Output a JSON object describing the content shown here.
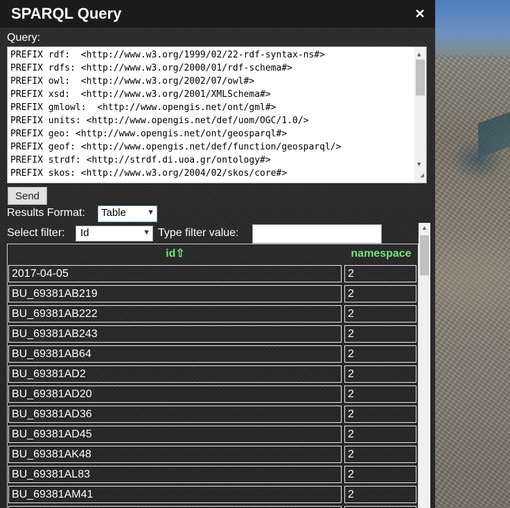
{
  "window": {
    "title": "SPARQL Query",
    "close_symbol": "✕"
  },
  "query": {
    "label": "Query:",
    "lines": [
      "PREFIX rdf:  <http://www.w3.org/1999/02/22-rdf-syntax-ns#>",
      "PREFIX rdfs: <http://www.w3.org/2000/01/rdf-schema#>",
      "PREFIX owl:  <http://www.w3.org/2002/07/owl#>",
      "PREFIX xsd:  <http://www.w3.org/2001/XMLSchema#>",
      "PREFIX gmlowl:  <http://www.opengis.net/ont/gml#>",
      "PREFIX units: <http://www.opengis.net/def/uom/OGC/1.0/>",
      "PREFIX geo: <http://www.opengis.net/ont/geosparql#>",
      "PREFIX geof: <http://www.opengis.net/def/function/geosparql/>",
      "PREFIX strdf: <http://strdf.di.uoa.gr/ontology#>",
      "PREFIX skos: <http://www.w3.org/2004/02/skos/core#>"
    ]
  },
  "send_label": "Send",
  "results_format": {
    "label": "Results Format:",
    "selected": "Table"
  },
  "filter": {
    "label": "Select filter:",
    "selected": "Id",
    "value_label": "Type filter value:",
    "value": ""
  },
  "table": {
    "headers": [
      "id⇧",
      "namespace"
    ],
    "rows": [
      [
        "2017-04-05",
        "2"
      ],
      [
        "BU_69381AB219",
        "2"
      ],
      [
        "BU_69381AB222",
        "2"
      ],
      [
        "BU_69381AB243",
        "2"
      ],
      [
        "BU_69381AB64",
        "2"
      ],
      [
        "BU_69381AD2",
        "2"
      ],
      [
        "BU_69381AD20",
        "2"
      ],
      [
        "BU_69381AD36",
        "2"
      ],
      [
        "BU_69381AD45",
        "2"
      ],
      [
        "BU_69381AK48",
        "2"
      ],
      [
        "BU_69381AL83",
        "2"
      ],
      [
        "BU_69381AM41",
        "2"
      ],
      [
        "",
        ""
      ]
    ]
  },
  "colors": {
    "header_green": "#76e27c",
    "titlebar": "#1b1b1b",
    "panel": "#2b2b2b"
  }
}
